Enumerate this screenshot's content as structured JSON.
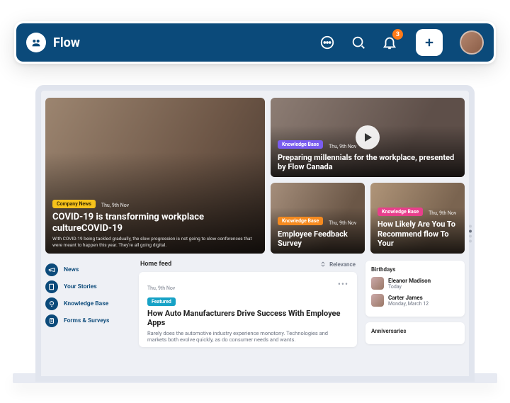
{
  "header": {
    "brand": "Flow",
    "notification_count": "3"
  },
  "hero": {
    "big": {
      "chip": "Company News",
      "date": "Thu, 9th Nov",
      "title": "COVID-19 is transforming workplace cultureCOVID-19",
      "body": "With COVID-19 being tackled gradually, the slow progression is not going to slow conferences that were meant to happen this year. They're all going digital."
    },
    "wide": {
      "chip": "Knowledge Base",
      "date": "Thu, 9th Nov",
      "title": "Preparing millennials for the workplace, presented by Flow Canada"
    },
    "small_left": {
      "chip": "Knowledge Base",
      "date": "Thu, 9th Nov",
      "title": "Employee Feedback Survey"
    },
    "small_right": {
      "chip": "Knowledge Base",
      "date": "Thu, 9th Nov",
      "title": "How Likely Are You To Recommend flow To Your"
    }
  },
  "nav": {
    "items": [
      {
        "label": "News"
      },
      {
        "label": "Your Stories"
      },
      {
        "label": "Knowledge Base"
      },
      {
        "label": "Forms & Surveys"
      }
    ]
  },
  "feed": {
    "heading": "Home feed",
    "sort": "Relevance",
    "card": {
      "date": "Thu, 9th Nov",
      "tag": "Featured",
      "title": "How Auto Manufacturers Drive Success With Employee Apps",
      "body": "Rarely does the automotive industry experience monotony. Technologies and markets both evolve quickly, as do consumer needs and wants."
    }
  },
  "side": {
    "birthdays_heading": "Birthdays",
    "people": [
      {
        "name": "Eleanor Madison",
        "sub": "Today"
      },
      {
        "name": "Carter James",
        "sub": "Monday, March 12"
      }
    ],
    "anniv_heading": "Anniversaries"
  }
}
